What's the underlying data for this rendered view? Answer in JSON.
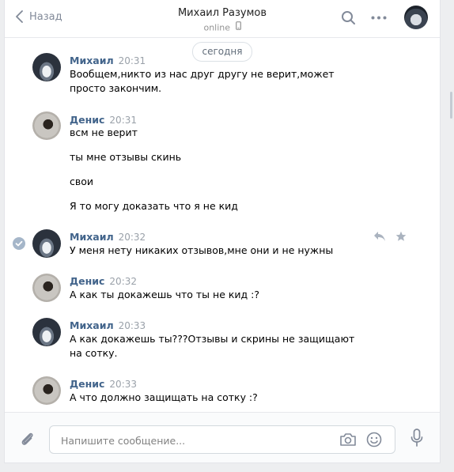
{
  "header": {
    "back_label": "Назад",
    "title": "Михаил Разумов",
    "status": "online"
  },
  "date_divider": "сегодня",
  "messages": [
    {
      "author": "Михаил",
      "time": "20:31",
      "lines": [
        "Вообщем,никто из нас друг другу не верит,может просто закончим."
      ]
    },
    {
      "author": "Денис",
      "time": "20:31",
      "lines": [
        "всм не верит",
        "ты мне отзывы скинь",
        "свои",
        "Я то могу доказать что я не кид"
      ]
    },
    {
      "author": "Михаил",
      "time": "20:32",
      "lines": [
        "У меня нету никаких отзывов,мне они и не нужны"
      ]
    },
    {
      "author": "Денис",
      "time": "20:32",
      "lines": [
        "А как ты докажешь что ты не кид :?"
      ]
    },
    {
      "author": "Михаил",
      "time": "20:33",
      "lines": [
        "А как докажешь ты???Отзывы и скрины не защищают на сотку."
      ]
    },
    {
      "author": "Денис",
      "time": "20:33",
      "lines": [
        "А что должно защищать на сотку :?"
      ]
    }
  ],
  "composer": {
    "placeholder": "Напишите сообщение..."
  },
  "icons": {
    "back": "chevron-left-icon",
    "search": "search-icon",
    "more": "more-icon",
    "phone": "mobile-phone-icon",
    "reply": "reply-icon",
    "star": "star-icon",
    "attach": "paperclip-icon",
    "camera": "camera-icon",
    "emoji": "emoji-icon",
    "mic": "microphone-icon",
    "check": "check-icon"
  }
}
